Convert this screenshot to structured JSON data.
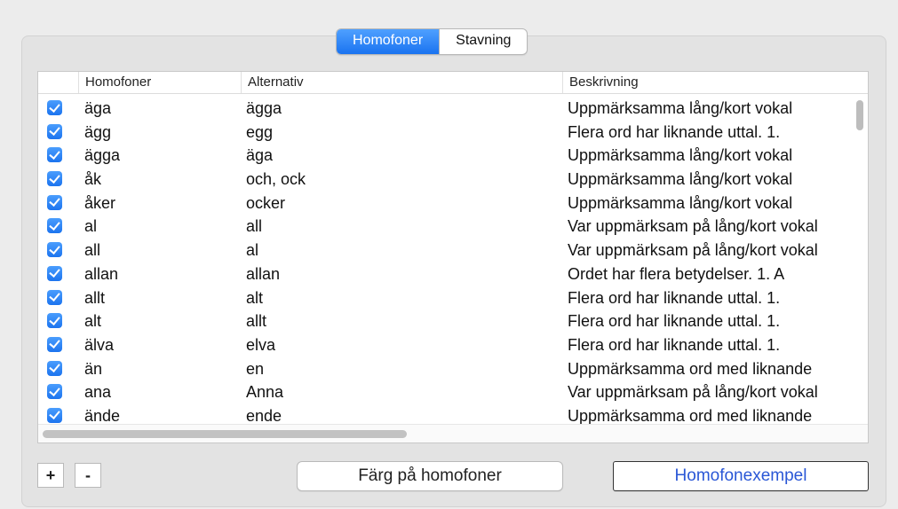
{
  "tabs": {
    "homofoner": "Homofoner",
    "stavning": "Stavning"
  },
  "table": {
    "headers": {
      "homofoner": "Homofoner",
      "alternativ": "Alternativ",
      "beskrivning": "Beskrivning"
    },
    "rows": [
      {
        "word": "äga",
        "alt": "ägga",
        "desc": "Uppmärksamma lång/kort vokal"
      },
      {
        "word": "ägg",
        "alt": "egg",
        "desc": "Flera ord har liknande uttal. 1."
      },
      {
        "word": "ägga",
        "alt": "äga",
        "desc": "Uppmärksamma lång/kort vokal"
      },
      {
        "word": "åk",
        "alt": "och, ock",
        "desc": "Uppmärksamma lång/kort vokal"
      },
      {
        "word": "åker",
        "alt": "ocker",
        "desc": "Uppmärksamma lång/kort vokal"
      },
      {
        "word": "al",
        "alt": "all",
        "desc": "Var uppmärksam på lång/kort vokal"
      },
      {
        "word": "all",
        "alt": "al",
        "desc": "Var uppmärksam på lång/kort vokal"
      },
      {
        "word": "allan",
        "alt": "allan",
        "desc": "Ordet har flera betydelser. 1. A"
      },
      {
        "word": "allt",
        "alt": "alt",
        "desc": "Flera ord har liknande uttal. 1."
      },
      {
        "word": "alt",
        "alt": "allt",
        "desc": "Flera ord har liknande uttal. 1."
      },
      {
        "word": "älva",
        "alt": "elva",
        "desc": "Flera ord har liknande uttal. 1."
      },
      {
        "word": "än",
        "alt": "en",
        "desc": "Uppmärksamma ord med liknande"
      },
      {
        "word": "ana",
        "alt": "Anna",
        "desc": "Var uppmärksam på lång/kort vokal"
      },
      {
        "word": "ände",
        "alt": "ende",
        "desc": "Uppmärksamma ord med liknande"
      }
    ]
  },
  "buttons": {
    "add": "+",
    "remove": "-",
    "color": "Färg på homofoner",
    "example": "Homofonexempel"
  },
  "colors": {
    "accent": "#1a73f0",
    "link_text": "#2a57d6"
  }
}
